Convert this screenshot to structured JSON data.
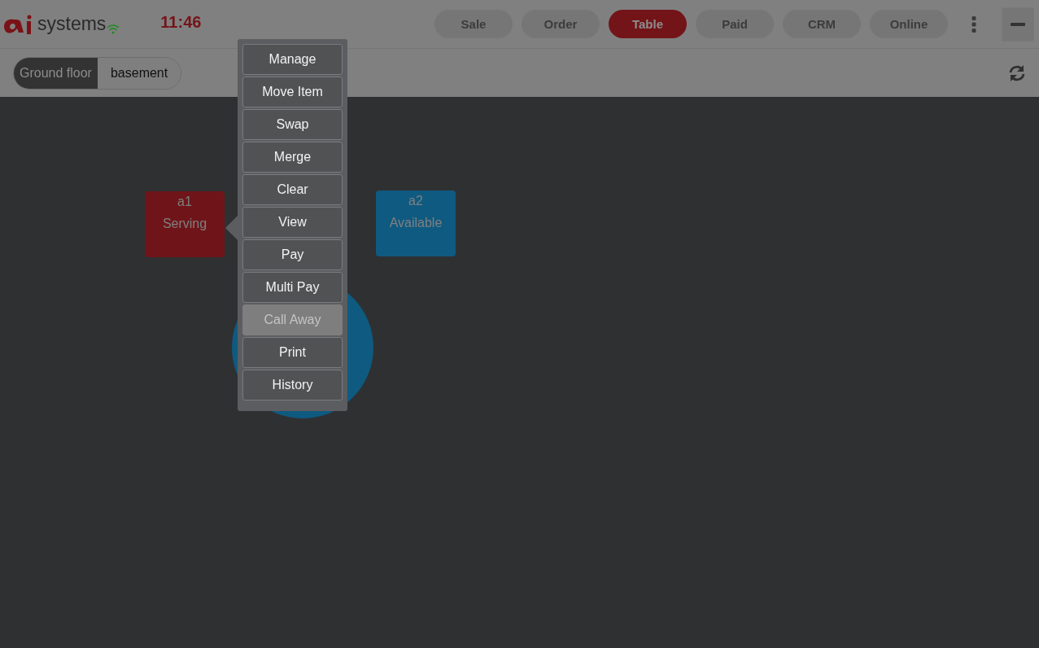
{
  "header": {
    "brand": "systems",
    "time": "11:46",
    "nav": [
      {
        "label": "Sale",
        "selected": false
      },
      {
        "label": "Order",
        "selected": false
      },
      {
        "label": "Table",
        "selected": true
      },
      {
        "label": "Paid",
        "selected": false
      },
      {
        "label": "CRM",
        "selected": false
      },
      {
        "label": "Online",
        "selected": false
      }
    ]
  },
  "floors": [
    {
      "label": "Ground floor",
      "selected": true
    },
    {
      "label": "basement",
      "selected": false
    }
  ],
  "tables": [
    {
      "kind": "square",
      "name": "a1",
      "status": "Serving",
      "color": "#6f1519"
    },
    {
      "kind": "square",
      "name": "a2",
      "status": "Available",
      "color": "#0f5a80"
    },
    {
      "kind": "round",
      "color": "#0f5a80"
    }
  ],
  "menu": [
    {
      "label": "Manage",
      "disabled": false
    },
    {
      "label": "Move Item",
      "disabled": false
    },
    {
      "label": "Swap",
      "disabled": false
    },
    {
      "label": "Merge",
      "disabled": false
    },
    {
      "label": "Clear",
      "disabled": false
    },
    {
      "label": "View",
      "disabled": false
    },
    {
      "label": "Pay",
      "disabled": false
    },
    {
      "label": "Multi Pay",
      "disabled": false
    },
    {
      "label": "Call Away",
      "disabled": true
    },
    {
      "label": "Print",
      "disabled": false
    },
    {
      "label": "History",
      "disabled": false
    }
  ]
}
